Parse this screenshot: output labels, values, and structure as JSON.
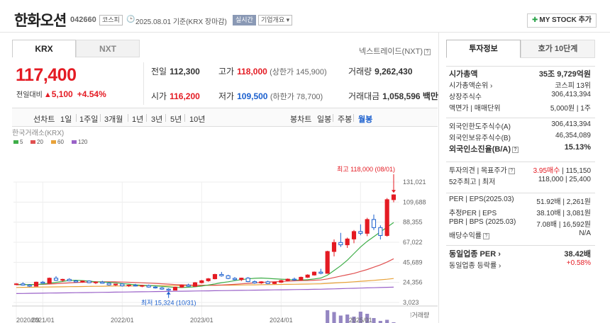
{
  "header": {
    "name": "한화오션",
    "code": "042660",
    "market": "코스피",
    "date_label": "2025.08.01 기준(KRX 장마감)",
    "live_label": "실시간",
    "info_label": "기업개요 ▾",
    "mystock_label": "MY STOCK 추가"
  },
  "market_tabs": [
    "KRX",
    "NXT"
  ],
  "nxt_link": "넥스트레이드(NXT)",
  "quote": {
    "price": "117,400",
    "change_label": "전일대비",
    "change": "5,100",
    "change_pct": "+4.54%",
    "prev_label": "전일",
    "prev": "112,300",
    "high_label": "고가",
    "high": "118,000",
    "high_limit": "(상한가 145,900)",
    "volume_label": "거래량",
    "volume": "9,262,430",
    "open_label": "시가",
    "open": "116,200",
    "low_label": "저가",
    "low": "109,500",
    "low_limit": "(하한가 78,700)",
    "amount_label": "거래대금",
    "amount": "1,058,596 백만"
  },
  "period": {
    "line_label": "선차트",
    "items": [
      "1일",
      "1주일",
      "3개월",
      "1년",
      "3년",
      "5년",
      "10년"
    ],
    "candle_label": "봉차트",
    "candle_items": [
      "일봉",
      "주봉",
      "월봉"
    ],
    "active_candle": "월봉"
  },
  "chart_data": {
    "type": "candlestick",
    "source_label": "한국거래소(KRX)",
    "ma_legend": [
      {
        "name": "5",
        "color": "#3fae49"
      },
      {
        "name": "20",
        "color": "#e05050"
      },
      {
        "name": "60",
        "color": "#e8a23a"
      },
      {
        "name": "120",
        "color": "#9a62c8"
      }
    ],
    "y_ticks": [
      "131,021",
      "109,688",
      "88,355",
      "67,022",
      "45,689",
      "24,356",
      "3,023"
    ],
    "ylim": [
      3023,
      131021
    ],
    "x_ticks": [
      {
        "label": "2020/09",
        "i": 0
      },
      {
        "label": "2021/01",
        "i": 4
      },
      {
        "label": "2022/01",
        "i": 16
      },
      {
        "label": "2023/01",
        "i": 28
      },
      {
        "label": "2024/01",
        "i": 40
      },
      {
        "label": "2025/01",
        "i": 52
      }
    ],
    "max_label": "최고 118,000 (08/01)",
    "min_label": "최저 15,324 (10/31)",
    "volume_label": "거래량",
    "up_color": "#e41b23",
    "down_color": "#1a5fce",
    "candles": [
      [
        22000,
        23500,
        21500,
        22800
      ],
      [
        22800,
        24500,
        21000,
        21500
      ],
      [
        21500,
        22500,
        19500,
        20300
      ],
      [
        20300,
        25200,
        20000,
        24600
      ],
      [
        24600,
        25800,
        23000,
        23500
      ],
      [
        23500,
        29500,
        23000,
        28800
      ],
      [
        28800,
        31000,
        26000,
        26600
      ],
      [
        26600,
        28200,
        25000,
        27600
      ],
      [
        27600,
        28800,
        25500,
        26000
      ],
      [
        26000,
        27000,
        24200,
        24800
      ],
      [
        24800,
        26300,
        24000,
        25800
      ],
      [
        25800,
        26500,
        23500,
        24000
      ],
      [
        24000,
        25400,
        22500,
        24700
      ],
      [
        24700,
        26000,
        23000,
        23400
      ],
      [
        23400,
        24300,
        21000,
        21700
      ],
      [
        21700,
        23000,
        20500,
        22600
      ],
      [
        22600,
        23500,
        20000,
        20700
      ],
      [
        20700,
        22000,
        19500,
        21400
      ],
      [
        21400,
        22800,
        20000,
        20500
      ],
      [
        20500,
        21800,
        19200,
        21000
      ],
      [
        21000,
        22000,
        18800,
        19400
      ],
      [
        19400,
        20600,
        17800,
        18500
      ],
      [
        18500,
        19400,
        16500,
        17200
      ],
      [
        17200,
        18200,
        15324,
        16100
      ],
      [
        16100,
        19800,
        15800,
        19300
      ],
      [
        19300,
        22200,
        18500,
        21500
      ],
      [
        21500,
        23000,
        19500,
        20200
      ],
      [
        20200,
        24800,
        19800,
        24000
      ],
      [
        24000,
        27000,
        23200,
        26100
      ],
      [
        26100,
        29000,
        25000,
        28200
      ],
      [
        28200,
        33500,
        27600,
        32800
      ],
      [
        32800,
        35500,
        30500,
        31400
      ],
      [
        31400,
        32500,
        27800,
        28600
      ],
      [
        28600,
        30000,
        26500,
        27300
      ],
      [
        27300,
        29400,
        25800,
        28900
      ],
      [
        28900,
        30000,
        24600,
        25200
      ],
      [
        25200,
        26500,
        23000,
        23800
      ],
      [
        23800,
        25600,
        22800,
        25000
      ],
      [
        25000,
        26200,
        22500,
        23100
      ],
      [
        23100,
        25000,
        22400,
        24500
      ],
      [
        24500,
        27000,
        23800,
        26300
      ],
      [
        26300,
        28500,
        25500,
        27800
      ],
      [
        27800,
        29500,
        26200,
        26900
      ],
      [
        26900,
        30500,
        26000,
        29800
      ],
      [
        29800,
        33000,
        29000,
        32200
      ],
      [
        32200,
        36000,
        31500,
        35300
      ],
      [
        35300,
        38800,
        33000,
        34000
      ],
      [
        34000,
        58000,
        33500,
        57200
      ],
      [
        57200,
        70000,
        52000,
        66800
      ],
      [
        66800,
        77000,
        62000,
        64300
      ],
      [
        64300,
        72000,
        61000,
        70500
      ],
      [
        70500,
        80000,
        66000,
        78400
      ],
      [
        78400,
        86000,
        74500,
        76500
      ],
      [
        76500,
        93000,
        73500,
        91200
      ],
      [
        91200,
        96500,
        80000,
        82600
      ],
      [
        82600,
        85000,
        70000,
        74200
      ],
      [
        74200,
        114000,
        73000,
        112300
      ],
      [
        112300,
        118000,
        109500,
        117400
      ]
    ],
    "volumes": [
      6,
      5,
      5,
      5,
      8,
      7,
      6,
      5,
      6,
      4,
      3,
      5,
      4,
      5,
      7,
      4,
      5,
      4,
      3,
      5,
      4,
      5,
      4,
      6,
      8,
      10,
      9,
      11,
      15,
      13,
      16,
      18,
      14,
      11,
      9,
      8,
      7,
      8,
      6,
      7,
      9,
      10,
      12,
      9,
      13,
      15,
      22,
      60,
      55,
      45,
      48,
      42,
      56,
      50,
      38,
      30,
      33,
      26
    ],
    "ma5": [
      22200,
      22100,
      21900,
      22200,
      22500,
      23400,
      24400,
      25300,
      26500,
      26600,
      26300,
      25700,
      25000,
      24800,
      24300,
      23900,
      23100,
      22500,
      21800,
      21300,
      21000,
      20700,
      20100,
      19600,
      19000,
      18900,
      19200,
      19700,
      20400,
      21600,
      22700,
      24000,
      25000,
      26200,
      27300,
      28100,
      28700,
      29000,
      28600,
      28200,
      27800,
      27400,
      27000,
      26800,
      27200,
      28000,
      29000,
      32000,
      37000,
      42000,
      48000,
      55000,
      62000,
      68000,
      73000,
      78000,
      83000,
      88000
    ],
    "ma20": [
      21800,
      21900,
      22000,
      22100,
      22300,
      22600,
      23000,
      23400,
      23800,
      24200,
      24500,
      24700,
      24900,
      25000,
      25000,
      24900,
      24700,
      24500,
      24200,
      23900,
      23600,
      23300,
      22900,
      22500,
      22100,
      21800,
      21600,
      21400,
      21300,
      21300,
      21400,
      21600,
      21900,
      22300,
      22800,
      23300,
      23800,
      24300,
      24700,
      25100,
      25400,
      25700,
      26000,
      26200,
      26400,
      26700,
      27000,
      28000,
      29500,
      31000,
      32500,
      34000,
      36000,
      38000,
      40500,
      43000,
      46000,
      49500
    ],
    "ma60": [
      19000,
      19100,
      19200,
      19300,
      19400,
      19500,
      19600,
      19700,
      19800,
      19900,
      20000,
      20100,
      20200,
      20300,
      20400,
      20500,
      20550,
      20600,
      20650,
      20700,
      20750,
      20800,
      20850,
      20900,
      20950,
      21000,
      21050,
      21100,
      21150,
      21200,
      21250,
      21300,
      21400,
      21500,
      21600,
      21700,
      21800,
      21900,
      22000,
      22100,
      22200,
      22300,
      22400,
      22500,
      22600,
      22750,
      22900,
      23300,
      23700,
      24100,
      24500,
      25000,
      25500,
      26000,
      26500,
      27100,
      27700,
      28500
    ],
    "ma120": [
      12500,
      12600,
      12700,
      12800,
      12900,
      13000,
      13100,
      13200,
      13300,
      13400,
      13500,
      13600,
      13700,
      13800,
      13900,
      14000,
      14100,
      14200,
      14300,
      14400,
      14500,
      14600,
      14700,
      14800,
      14900,
      15000,
      15100,
      15200,
      15300,
      15400,
      15500,
      15600,
      15700,
      15800,
      15900,
      16000,
      16100,
      16200,
      16300,
      16400,
      16500,
      16600,
      16700,
      16800,
      16900,
      17000,
      17100,
      17300,
      17500,
      17700,
      17900,
      18100,
      18300,
      18500,
      18700,
      18900,
      19100,
      19300
    ]
  },
  "invest": {
    "tabs": [
      "투자정보",
      "호가 10단계"
    ],
    "g1": [
      {
        "k": "시가총액",
        "v": "35조 9,729억원",
        "bold": true
      },
      {
        "k": "시가총액순위 ›",
        "v": "코스피 13위"
      },
      {
        "k": "상장주식수",
        "v": "306,413,394"
      },
      {
        "k": "액면가 | 매매단위",
        "v": "5,000원 | 1주"
      }
    ],
    "g2": [
      {
        "k": "외국인한도주식수(A)",
        "v": "306,413,394"
      },
      {
        "k": "외국인보유주식수(B)",
        "v": "46,354,089"
      },
      {
        "k": "외국인소진율(B/A)",
        "v": "15.13%",
        "bold": true
      }
    ],
    "g3": [
      {
        "k": "투자의견 | 목표주가",
        "v_red": "3.95매수",
        "v": "| 115,150"
      },
      {
        "k": "52주최고 | 최저",
        "v": "118,000 | 25,400"
      }
    ],
    "g4": [
      {
        "k": "PER | EPS(2025.03)",
        "v": "51.92배 | 2,261원"
      },
      {
        "k": "추정PER | EPS",
        "v": "38.10배 | 3,081원"
      },
      {
        "k": "PBR | BPS (2025.03)",
        "v": "7.08배 | 16,592원"
      },
      {
        "k": "배당수익률",
        "v": "N/A"
      }
    ],
    "g5": [
      {
        "k": "동일업종 PER ›",
        "v": "38.42배",
        "bold": true
      },
      {
        "k": "동일업종 등락률 ›",
        "v": "+0.58%",
        "red": true
      }
    ]
  }
}
